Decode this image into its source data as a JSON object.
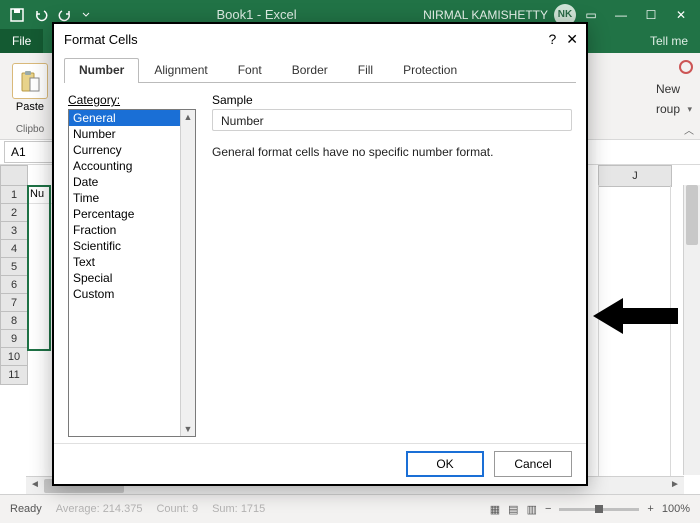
{
  "titlebar": {
    "doc_title": "Book1 - Excel",
    "user_name": "NIRMAL KAMISHETTY",
    "user_initials": "NK"
  },
  "ribbon": {
    "tabs": {
      "file": "File",
      "tellme": "Tell me"
    },
    "clipboard": {
      "paste": "Paste",
      "group": "Clipbo"
    },
    "editing": {
      "new": "New",
      "group": "roup"
    }
  },
  "namebox": {
    "value": "A1"
  },
  "grid": {
    "col_header": "J",
    "rows": [
      "1",
      "2",
      "3",
      "4",
      "5",
      "6",
      "7",
      "8",
      "9",
      "10",
      "11"
    ],
    "a1_value": "Nu"
  },
  "statusbar": {
    "ready": "Ready",
    "average_label": "Average:",
    "average_value": "214.375",
    "count_label": "Count:",
    "count_value": "9",
    "sum_label": "Sum:",
    "sum_value": "1715",
    "zoom": "100%",
    "plus": "+"
  },
  "dialog": {
    "title": "Format Cells",
    "tabs": [
      "Number",
      "Alignment",
      "Font",
      "Border",
      "Fill",
      "Protection"
    ],
    "active_tab": 0,
    "category_label": "Category:",
    "categories": [
      "General",
      "Number",
      "Currency",
      "Accounting",
      "Date",
      "Time",
      "Percentage",
      "Fraction",
      "Scientific",
      "Text",
      "Special",
      "Custom"
    ],
    "selected_category": 0,
    "sample_label": "Sample",
    "sample_value": "Number",
    "description": "General format cells have no specific number format.",
    "ok": "OK",
    "cancel": "Cancel"
  }
}
